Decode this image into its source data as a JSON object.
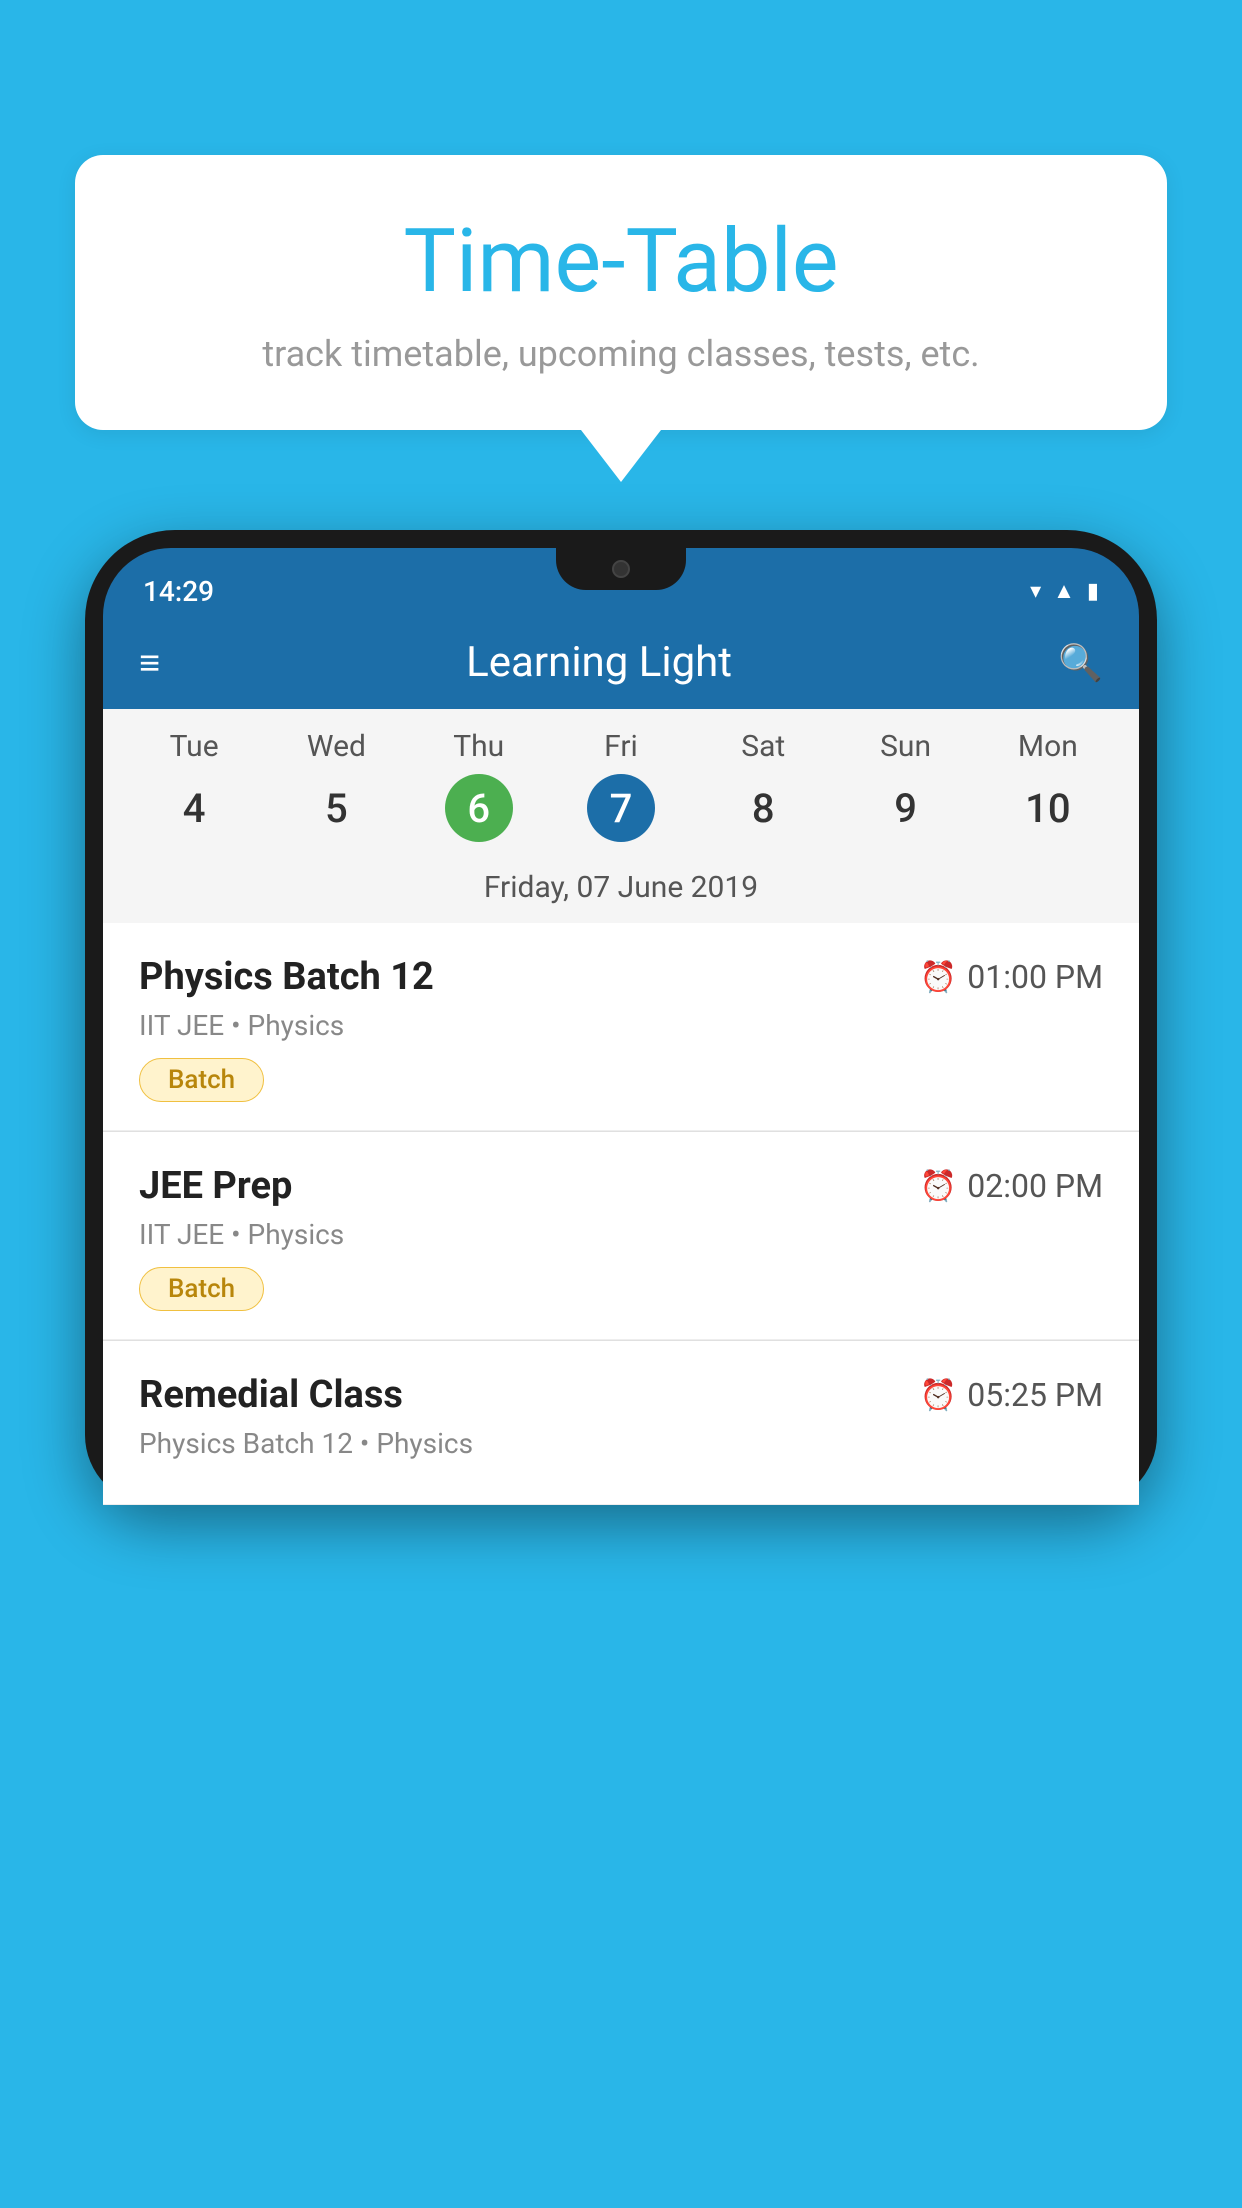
{
  "background_color": "#29b6e8",
  "speech_bubble": {
    "title": "Time-Table",
    "subtitle": "track timetable, upcoming classes, tests, etc."
  },
  "phone": {
    "status_bar": {
      "time": "14:29"
    },
    "app_bar": {
      "title": "Learning Light",
      "menu_icon": "≡",
      "search_icon": "🔍"
    },
    "calendar": {
      "days_of_week": [
        "Tue",
        "Wed",
        "Thu",
        "Fri",
        "Sat",
        "Sun",
        "Mon"
      ],
      "day_numbers": [
        "4",
        "5",
        "6",
        "7",
        "8",
        "9",
        "10"
      ],
      "today_index": 2,
      "selected_index": 3,
      "selected_date_label": "Friday, 07 June 2019"
    },
    "schedule_items": [
      {
        "title": "Physics Batch 12",
        "time": "01:00 PM",
        "subtitle": "IIT JEE • Physics",
        "tag": "Batch"
      },
      {
        "title": "JEE Prep",
        "time": "02:00 PM",
        "subtitle": "IIT JEE • Physics",
        "tag": "Batch"
      },
      {
        "title": "Remedial Class",
        "time": "05:25 PM",
        "subtitle": "Physics Batch 12 • Physics",
        "tag": null
      }
    ]
  }
}
